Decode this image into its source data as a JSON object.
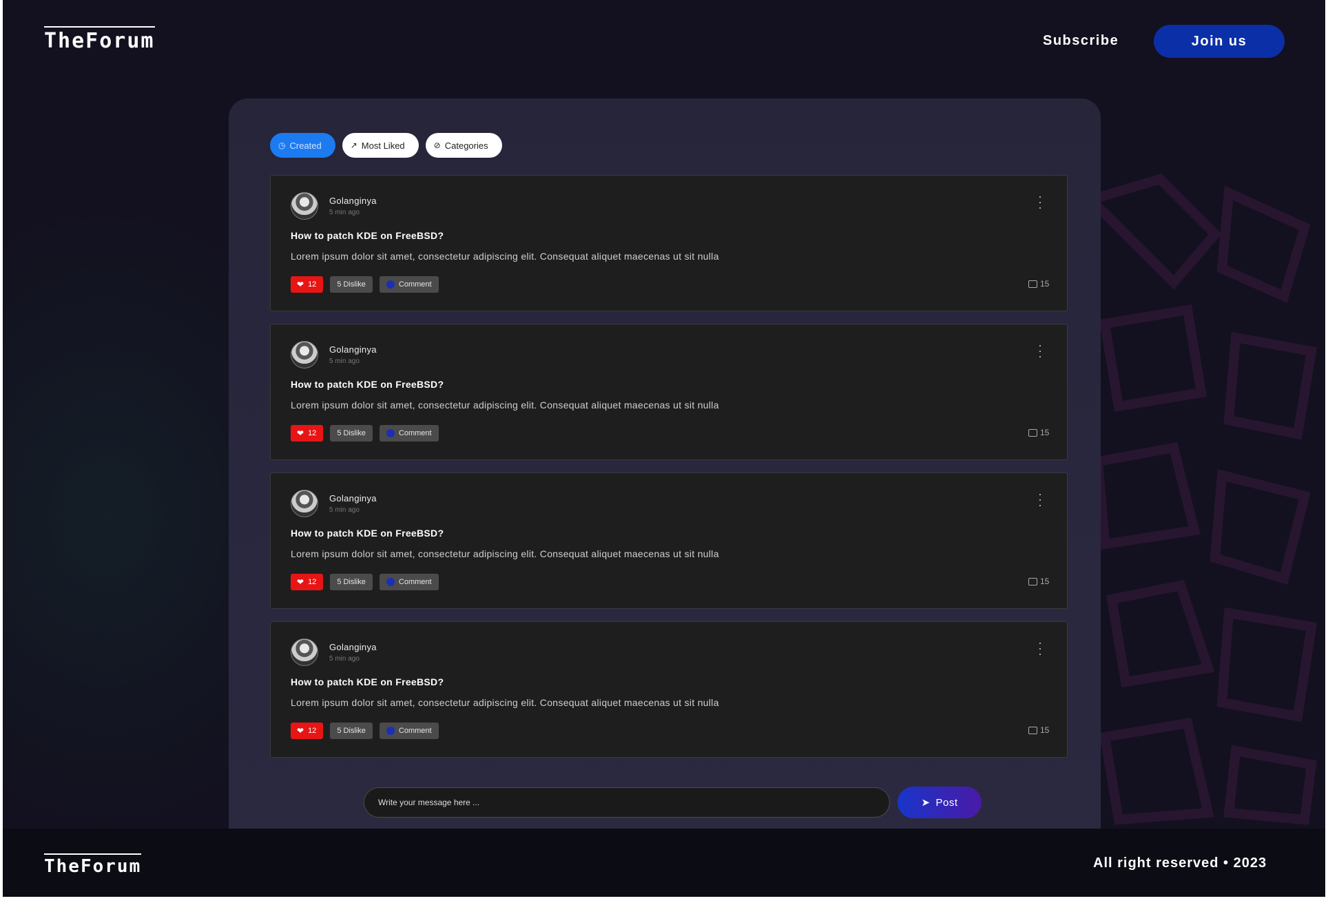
{
  "header": {
    "logo": "TheForum",
    "subscribe_label": "Subscribe",
    "join_label": "Join us"
  },
  "filters": [
    {
      "label": "Created",
      "icon": "clock-icon",
      "active": true
    },
    {
      "label": "Most Liked",
      "icon": "arrow-up-right-icon",
      "active": false
    },
    {
      "label": "Categories",
      "icon": "check-circle-icon",
      "active": false
    }
  ],
  "posts": [
    {
      "author": "Golanginya",
      "time": "5 min ago",
      "title": "How to patch KDE on FreeBSD?",
      "body": "Lorem ipsum dolor sit amet, consectetur adipiscing elit. Consequat aliquet maecenas ut sit nulla",
      "likes": "12",
      "dislike_label": "5 Dislike",
      "comment_label": "Comment",
      "comments": "15"
    },
    {
      "author": "Golanginya",
      "time": "5 min ago",
      "title": "How to patch KDE on FreeBSD?",
      "body": "Lorem ipsum dolor sit amet, consectetur adipiscing elit. Consequat aliquet maecenas ut sit nulla",
      "likes": "12",
      "dislike_label": "5 Dislike",
      "comment_label": "Comment",
      "comments": "15"
    },
    {
      "author": "Golanginya",
      "time": "5 min ago",
      "title": "How to patch KDE on FreeBSD?",
      "body": "Lorem ipsum dolor sit amet, consectetur adipiscing elit. Consequat aliquet maecenas ut sit nulla",
      "likes": "12",
      "dislike_label": "5 Dislike",
      "comment_label": "Comment",
      "comments": "15"
    },
    {
      "author": "Golanginya",
      "time": "5 min ago",
      "title": "How to patch KDE on FreeBSD?",
      "body": "Lorem ipsum dolor sit amet, consectetur adipiscing elit. Consequat aliquet maecenas ut sit nulla",
      "likes": "12",
      "dislike_label": "5 Dislike",
      "comment_label": "Comment",
      "comments": "15"
    }
  ],
  "composer": {
    "placeholder": "Write your message here ...",
    "post_label": "Post"
  },
  "footer": {
    "logo": "TheForum",
    "rights": "All right reserved • 2023"
  },
  "colors": {
    "background": "#13111f",
    "panel": "#27253a",
    "accent_blue": "#0b2fa6",
    "active_tab": "#1d7bf2",
    "like_red": "#e81515"
  }
}
